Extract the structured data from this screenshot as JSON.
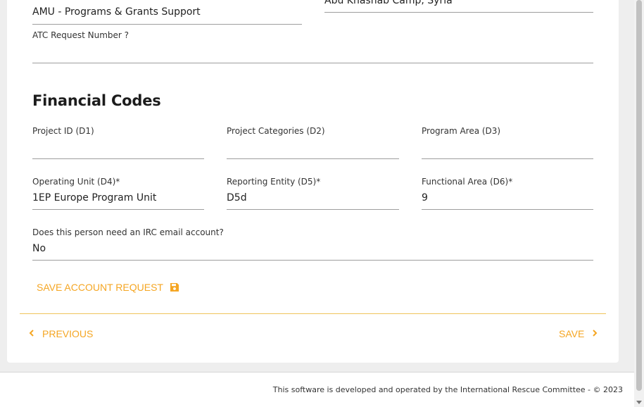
{
  "top_fields": {
    "org_unit_value": "AMU - Programs & Grants Support",
    "location_value": "Abu Khashab Camp, Syria"
  },
  "atc": {
    "label": "ATC Request Number ?",
    "value": ""
  },
  "financial": {
    "title": "Financial Codes",
    "project_id_label": "Project ID (D1)",
    "project_id_value": "",
    "project_categories_label": "Project Categories (D2)",
    "project_categories_value": "",
    "program_area_label": "Program Area (D3)",
    "program_area_value": "",
    "operating_unit_label": "Operating Unit (D4)*",
    "operating_unit_value": "1EP Europe Program Unit",
    "reporting_entity_label": "Reporting Entity (D5)*",
    "reporting_entity_value": "D5d",
    "functional_area_label": "Functional Area (D6)*",
    "functional_area_value": "9"
  },
  "email": {
    "label": "Does this person need an IRC email account?",
    "value": "No"
  },
  "actions": {
    "save_account_label": "SAVE ACCOUNT REQUEST",
    "save_icon": "floppy-disk-icon",
    "previous_label": "PREVIOUS",
    "save_label": "SAVE"
  },
  "footer": {
    "text": "This software is developed and operated by the International Rescue Committee - © 2023"
  },
  "colors": {
    "accent": "#f5a623",
    "divider": "#f0c45a",
    "underline": "#9e9e9e"
  }
}
